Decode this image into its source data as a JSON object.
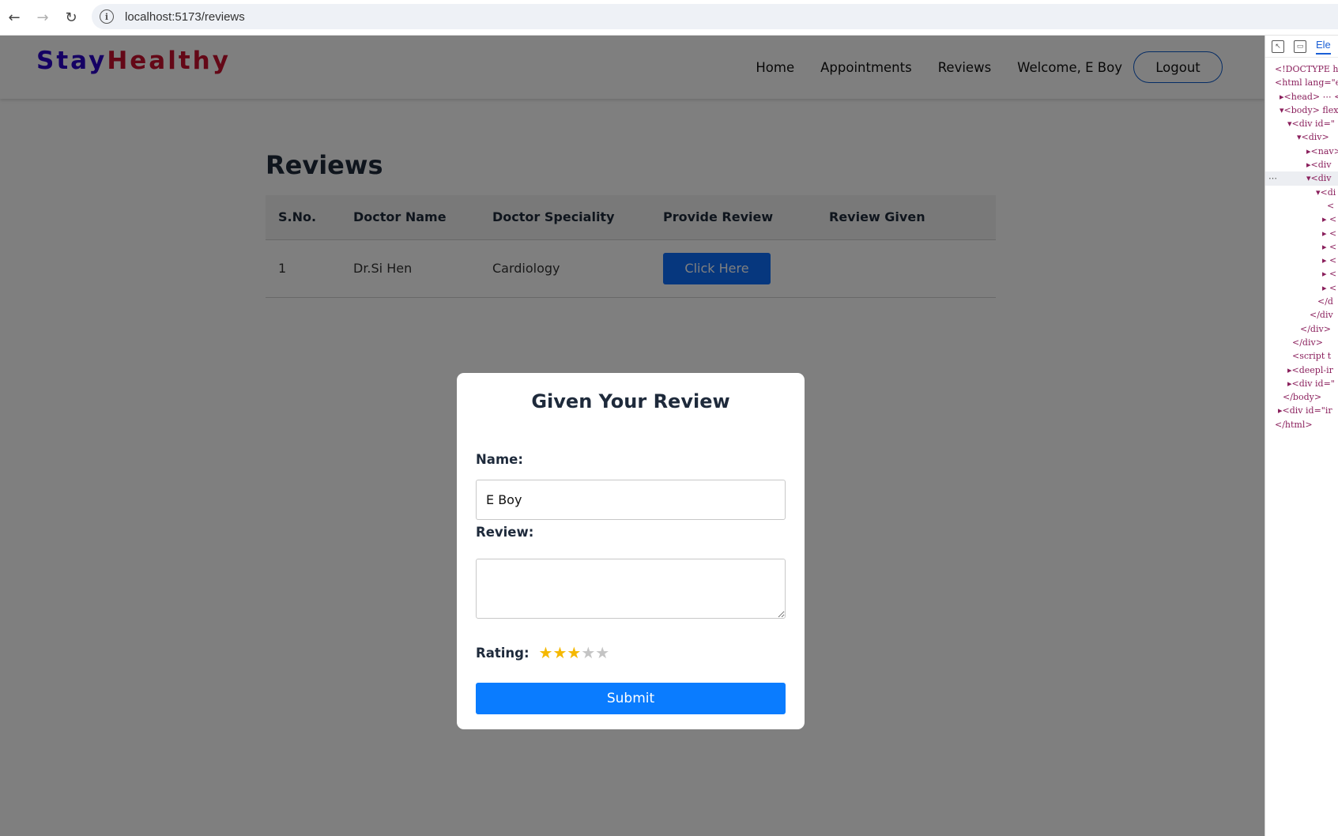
{
  "browser": {
    "url": "localhost:5173/reviews",
    "back_icon": "←",
    "forward_icon": "→",
    "reload_icon": "↻",
    "info_icon": "i"
  },
  "header": {
    "brand_part1": "Stay",
    "brand_part2": "Healthy",
    "nav": [
      "Home",
      "Appointments",
      "Reviews"
    ],
    "welcome": "Welcome, E Boy",
    "logout": "Logout"
  },
  "main": {
    "title": "Reviews",
    "columns": [
      "S.No.",
      "Doctor Name",
      "Doctor Speciality",
      "Provide Review",
      "Review Given"
    ],
    "rows": [
      {
        "sno": "1",
        "doctor": "Dr.Si Hen",
        "speciality": "Cardiology",
        "action": "Click Here",
        "review_given": ""
      }
    ]
  },
  "modal": {
    "title": "Given Your Review",
    "name_label": "Name:",
    "name_value": "E Boy",
    "review_label": "Review:",
    "review_value": "",
    "rating_label": "Rating:",
    "rating_value": 3,
    "rating_max": 5,
    "star_glyph": "★",
    "submit": "Submit"
  },
  "devtools": {
    "tab": "Ele",
    "lines": [
      "<!DOCTYPE htm",
      "<html lang=\"e",
      "▸<head> ⋯ </",
      "▾<body> flex",
      "▾<div id=\"",
      "▾<div>",
      "▸<nav>",
      "▸<div",
      "▾<div",
      "▾<di",
      "<",
      "▸ <",
      "▸ <",
      "▸ <",
      "▸ <",
      "▸ <",
      "▸ <",
      "</d",
      "</div",
      "</div>",
      "</div>",
      "<script t",
      "▸<deepl-ir",
      "▸<div id=\"",
      "</body>",
      "▸<div id=\"ir",
      "</html>"
    ],
    "ellipsis": "⋯"
  },
  "colors": {
    "brand_part1": "#2a00c8",
    "brand_part2": "#c8102e",
    "primary_button": "#0d6efd",
    "submit_button": "#0a7cff",
    "star_on": "#f5b800",
    "star_off": "#c4c4c4",
    "overlay": "rgba(0,0,0,0.5)"
  }
}
